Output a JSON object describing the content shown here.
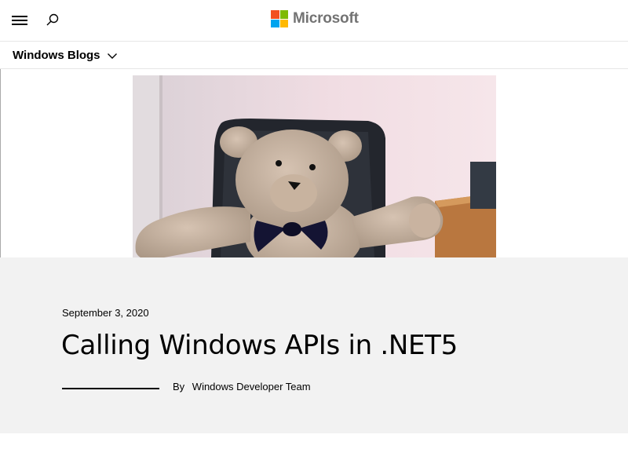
{
  "header": {
    "brand": "Microsoft",
    "brand_colors": [
      "#f25022",
      "#7fba00",
      "#00a4ef",
      "#ffb900"
    ],
    "menu_icon": "hamburger-menu-icon",
    "search_icon": "search-icon"
  },
  "subnav": {
    "label": "Windows Blogs",
    "icon": "chevron-down-icon"
  },
  "hero": {
    "image_subject": "teddy-bear-photo"
  },
  "article": {
    "date": "September 3, 2020",
    "title": "Calling Windows APIs in .NET5",
    "by_label": "By",
    "author": "Windows Developer Team"
  },
  "colors": {
    "band_background": "#f2f2f2",
    "divider": "#e6e6e6",
    "logo_text": "#737373"
  }
}
